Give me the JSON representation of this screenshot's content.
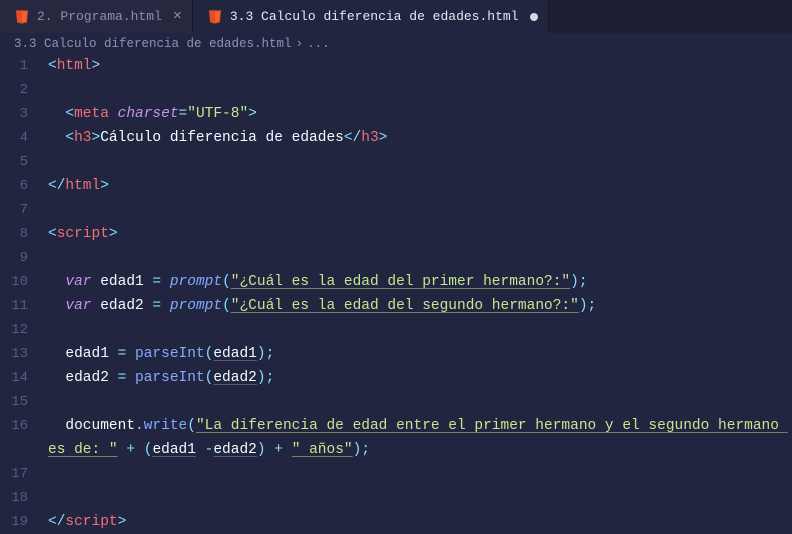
{
  "tabs": [
    {
      "label": "2. Programa.html",
      "active": false,
      "modified": false
    },
    {
      "label": "3.3 Calculo diferencia de edades.html",
      "active": true,
      "modified": true
    }
  ],
  "breadcrumb": {
    "item": "3.3 Calculo diferencia de edades.html",
    "sep": "›",
    "ellipsis": "..."
  },
  "lines": {
    "l1": {
      "no": "1",
      "tag_open": "<",
      "tag": "html",
      "tag_close": ">"
    },
    "l2": {
      "no": "2"
    },
    "l3": {
      "no": "3",
      "indent": "  ",
      "tag_open": "<",
      "tag": "meta",
      "attr": "charset",
      "eq": "=",
      "str": "\"UTF-8\"",
      "tag_close": ">"
    },
    "l4": {
      "no": "4",
      "indent": "  ",
      "tag_open": "<",
      "tag": "h3",
      "tag_close_open": ">",
      "text": "Cálculo diferencia de edades",
      "end_open": "</",
      "end_tag": "h3",
      "end_close": ">"
    },
    "l5": {
      "no": "5"
    },
    "l6": {
      "no": "6",
      "end_open": "</",
      "tag": "html",
      "end_close": ">"
    },
    "l7": {
      "no": "7"
    },
    "l8": {
      "no": "8",
      "tag_open": "<",
      "tag": "script",
      "tag_close": ">"
    },
    "l9": {
      "no": "9"
    },
    "l10": {
      "no": "10",
      "indent": "  ",
      "kw": "var",
      "var": "edad1",
      "eq": " = ",
      "fn": "prompt",
      "lpar": "(",
      "str": "\"¿Cuál es la edad del primer hermano?:\"",
      "rpar": ")",
      "semi": ";"
    },
    "l11": {
      "no": "11",
      "indent": "  ",
      "kw": "var",
      "var": "edad2",
      "eq": " = ",
      "fn": "prompt",
      "lpar": "(",
      "str": "\"¿Cuál es la edad del segundo hermano?:\"",
      "rpar": ")",
      "semi": ";"
    },
    "l12": {
      "no": "12"
    },
    "l13": {
      "no": "13",
      "indent": "  ",
      "var": "edad1",
      "eq": " = ",
      "fn": "parseInt",
      "lpar": "(",
      "arg": "edad1",
      "rpar": ")",
      "semi": ";"
    },
    "l14": {
      "no": "14",
      "indent": "  ",
      "var": "edad2",
      "eq": " = ",
      "fn": "parseInt",
      "lpar": "(",
      "arg": "edad2",
      "rpar": ")",
      "semi": ";"
    },
    "l15": {
      "no": "15"
    },
    "l16": {
      "no": "16",
      "indent": "  ",
      "obj": "document",
      "dot": ".",
      "method": "write",
      "lpar": "(",
      "str1": "\"La diferencia de edad entre el primer hermano y el segundo hermano es de: \"",
      "plus1": " + ",
      "lpar2": "(",
      "a1": "edad1",
      "minus": " -",
      "a2": "edad2",
      "rpar2": ")",
      "plus2": " + ",
      "str2": "\" años\"",
      "rpar": ")",
      "semi": ";"
    },
    "l17": {
      "no": "17"
    },
    "l18": {
      "no": "18"
    },
    "l19": {
      "no": "19",
      "end_open": "</",
      "tag": "script",
      "end_close": ">"
    }
  }
}
